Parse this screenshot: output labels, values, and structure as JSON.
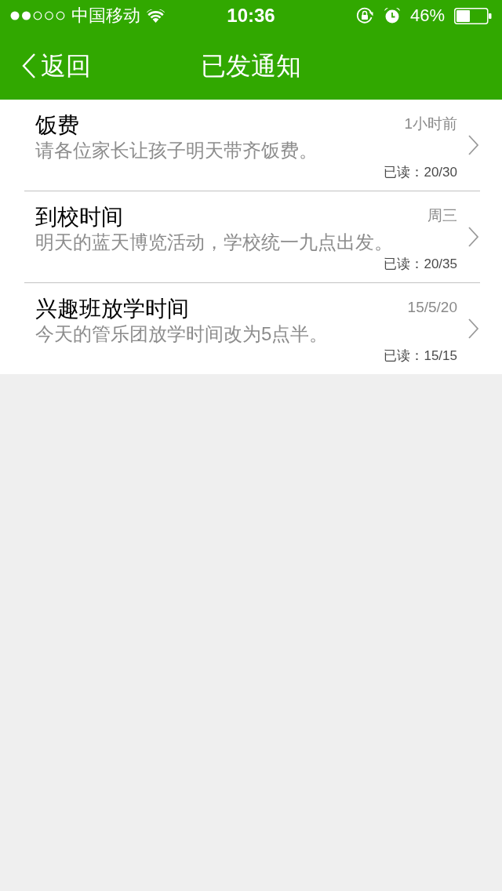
{
  "status_bar": {
    "carrier": "中国移动",
    "time": "10:36",
    "battery": "46%"
  },
  "nav_bar": {
    "back": "返回",
    "title": "已发通知"
  },
  "notifications": [
    {
      "title": "饭费",
      "time": "1小时前",
      "preview": "请各位家长让孩子明天带齐饭费。",
      "read_count": "已读：20/30"
    },
    {
      "title": "到校时间",
      "time": "周三",
      "preview": "明天的蓝天博览活动，学校统一九点出发。",
      "read_count": "已读：20/35"
    },
    {
      "title": "兴趣班放学时间",
      "time": "15/5/20",
      "preview": "今天的管乐团放学时间改为5点半。",
      "read_count": "已读：15/15"
    }
  ]
}
